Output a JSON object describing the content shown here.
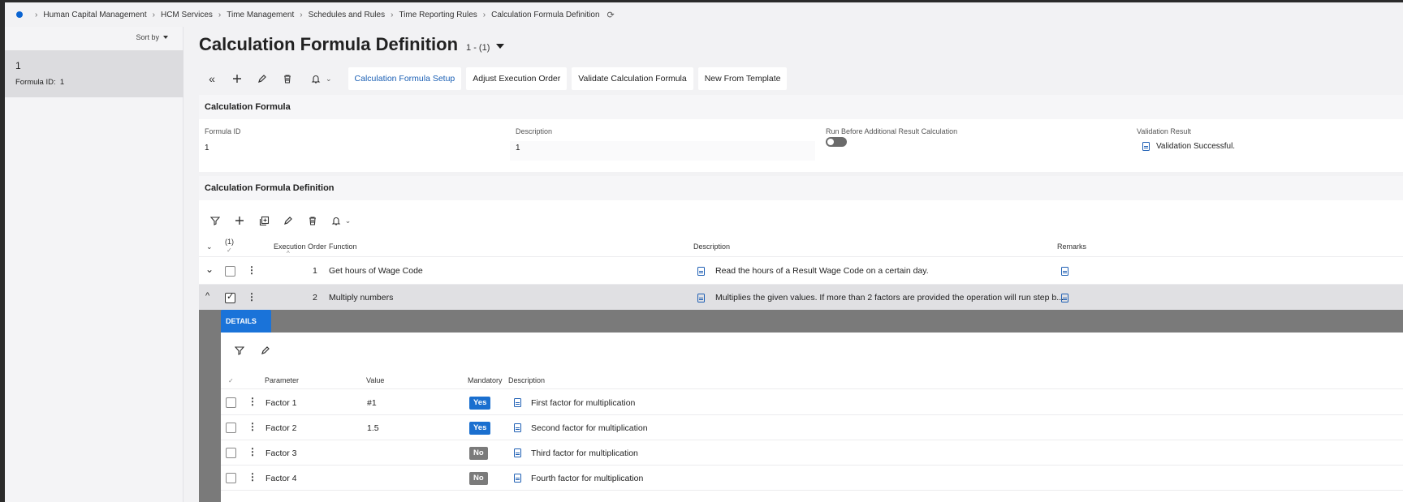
{
  "breadcrumb": [
    "Human Capital Management",
    "HCM Services",
    "Time Management",
    "Schedules and Rules",
    "Time Reporting Rules",
    "Calculation Formula Definition"
  ],
  "left_panel": {
    "sort_label": "Sort by",
    "item_title": "1",
    "item_sub_label": "Formula ID:",
    "item_sub_value": "1"
  },
  "page": {
    "title": "Calculation Formula Definition",
    "count": "1 - (1)"
  },
  "toolbar": {
    "buttons": [
      "Calculation Formula Setup",
      "Adjust Execution Order",
      "Validate Calculation Formula",
      "New From Template"
    ]
  },
  "calc_formula": {
    "header": "Calculation Formula",
    "formula_id_label": "Formula ID",
    "formula_id_value": "1",
    "description_label": "Description",
    "description_value": "1",
    "run_before_label": "Run Before Additional Result Calculation",
    "run_before_value": false,
    "validation_label": "Validation Result",
    "validation_value": "Validation Successful."
  },
  "definition": {
    "header": "Calculation Formula Definition",
    "selected_count": "(1)",
    "columns": {
      "execution_order": "Execution Order",
      "function": "Function",
      "description": "Description",
      "remarks": "Remarks"
    },
    "rows": [
      {
        "order": "1",
        "function": "Get hours of Wage Code",
        "description": "Read the hours of a Result Wage Code on a certain day.",
        "checked": false,
        "expanded": false
      },
      {
        "order": "2",
        "function": "Multiply numbers",
        "description": "Multiplies the given values. If more than 2 factors are provided the operation will run step b...",
        "checked": true,
        "expanded": true
      }
    ]
  },
  "details": {
    "tab": "DETAILS",
    "columns": {
      "parameter": "Parameter",
      "value": "Value",
      "mandatory": "Mandatory",
      "description": "Description"
    },
    "rows": [
      {
        "parameter": "Factor 1",
        "value": "#1",
        "mandatory": "Yes",
        "description": "First factor for multiplication"
      },
      {
        "parameter": "Factor 2",
        "value": "1.5",
        "mandatory": "Yes",
        "description": "Second factor for multiplication"
      },
      {
        "parameter": "Factor 3",
        "value": "",
        "mandatory": "No",
        "description": "Third factor for multiplication"
      },
      {
        "parameter": "Factor 4",
        "value": "",
        "mandatory": "No",
        "description": "Fourth factor for multiplication"
      }
    ]
  },
  "colors": {
    "accent": "#1a73d9",
    "yes_badge": "#1a6fcf",
    "no_badge": "#7b7b7b",
    "details_band": "#7a7a7a"
  },
  "icons": [
    "collapse-all-icon",
    "plus-icon",
    "pencil-icon",
    "trash-icon",
    "bell-icon",
    "filter-icon",
    "duplicate-icon",
    "document-icon",
    "refresh-icon",
    "kebab-icon",
    "chevron-down-icon",
    "chevron-up-icon"
  ]
}
